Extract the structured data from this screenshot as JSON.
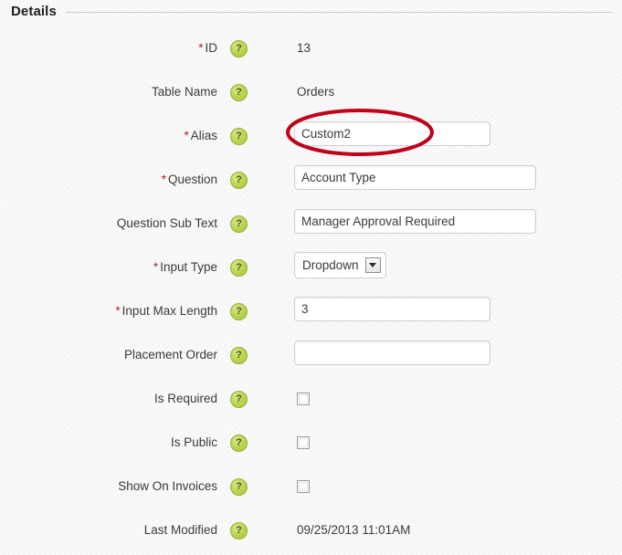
{
  "section": {
    "title": "Details"
  },
  "help_icon_glyph": "?",
  "required_marker": "*",
  "annotation": {
    "shape": "ellipse",
    "color": "#c00017",
    "target": "alias-input"
  },
  "rows": [
    {
      "label": "ID",
      "required": true,
      "help": "help-icon",
      "control": "static",
      "value": "13"
    },
    {
      "label": "Table Name",
      "required": false,
      "help": "help-icon",
      "control": "static",
      "value": "Orders"
    },
    {
      "label": "Alias",
      "required": true,
      "help": "help-icon",
      "control": "text",
      "width": "short",
      "value": "Custom2",
      "placeholder": ""
    },
    {
      "label": "Question",
      "required": true,
      "help": "help-icon",
      "control": "text",
      "width": "long",
      "value": "Account Type",
      "placeholder": ""
    },
    {
      "label": "Question Sub Text",
      "required": false,
      "help": "help-icon",
      "control": "text",
      "width": "long",
      "value": "Manager Approval Required",
      "placeholder": ""
    },
    {
      "label": "Input Type",
      "required": true,
      "help": "help-icon",
      "control": "select",
      "value": "Dropdown"
    },
    {
      "label": "Input Max Length",
      "required": true,
      "help": "help-icon",
      "control": "text",
      "width": "short",
      "value": "3",
      "placeholder": ""
    },
    {
      "label": "Placement Order",
      "required": false,
      "help": "help-icon",
      "control": "text",
      "width": "short",
      "value": "",
      "placeholder": ""
    },
    {
      "label": "Is Required",
      "required": false,
      "help": "help-icon",
      "control": "checkbox",
      "checked": false
    },
    {
      "label": "Is Public",
      "required": false,
      "help": "help-icon",
      "control": "checkbox",
      "checked": false
    },
    {
      "label": "Show On Invoices",
      "required": false,
      "help": "help-icon",
      "control": "checkbox",
      "checked": false
    },
    {
      "label": "Last Modified",
      "required": false,
      "help": "help-icon",
      "control": "static",
      "value": "09/25/2013 11:01AM"
    }
  ]
}
